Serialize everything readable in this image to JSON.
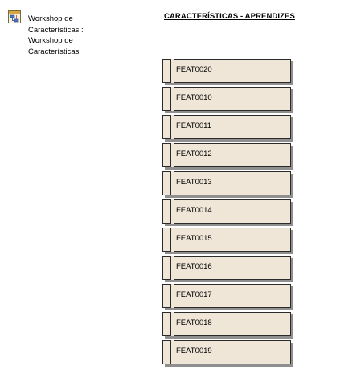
{
  "diagram": {
    "icon": "diagram-icon",
    "name": "Workshop de\nCaracterísticas :\nWorkshop de\nCaracterísticas",
    "title": "CARACTERÍSTICAS - APRENDIZES"
  },
  "features": [
    {
      "label": "FEAT0020"
    },
    {
      "label": "FEAT0010"
    },
    {
      "label": "FEAT0011"
    },
    {
      "label": "FEAT0012"
    },
    {
      "label": "FEAT0013"
    },
    {
      "label": "FEAT0014"
    },
    {
      "label": "FEAT0015"
    },
    {
      "label": "FEAT0016"
    },
    {
      "label": "FEAT0017"
    },
    {
      "label": "FEAT0018"
    },
    {
      "label": "FEAT0019"
    }
  ],
  "colors": {
    "box_fill": "#efe6d8",
    "box_border": "#2b2b2b",
    "shadow": "#8f8f8f"
  }
}
